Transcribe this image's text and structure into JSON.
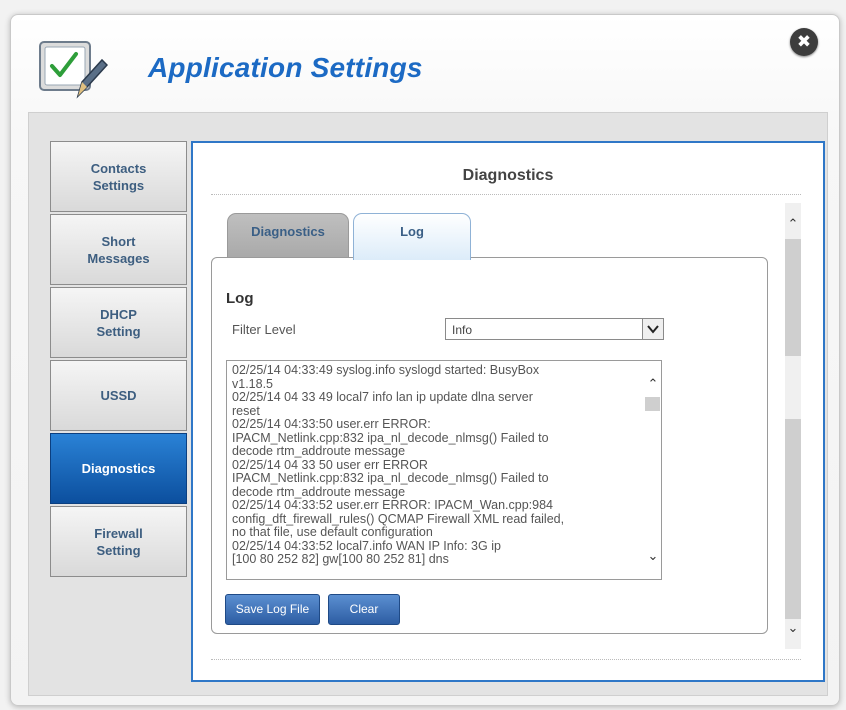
{
  "window": {
    "title": "Application Settings",
    "close_glyph": "✖",
    "app_icon": "checklist-pen-icon",
    "close_icon": "close-icon"
  },
  "sidebar": {
    "items": [
      {
        "label": "Contacts\nSettings",
        "active": false
      },
      {
        "label": "Short\nMessages",
        "active": false
      },
      {
        "label": "DHCP\nSetting",
        "active": false
      },
      {
        "label": "USSD",
        "active": false
      },
      {
        "label": "Diagnostics",
        "active": true
      },
      {
        "label": "Firewall\nSetting",
        "active": false
      }
    ]
  },
  "panel": {
    "title": "Diagnostics",
    "tabs": [
      {
        "label": "Diagnostics",
        "active": false
      },
      {
        "label": "Log",
        "active": true
      }
    ]
  },
  "log": {
    "heading": "Log",
    "filter_label": "Filter Level",
    "filter_value": "Info",
    "lines": [
      "02/25/14 04:33:49 syslog.info syslogd started: BusyBox",
      "v1.18.5",
      "02/25/14 04 33 49 local7 info  lan ip update dlna server",
      "reset",
      "02/25/14 04:33:50 user.err  ERROR:",
      "IPACM_Netlink.cpp:832 ipa_nl_decode_nlmsg() Failed to",
      "decode rtm_addroute message",
      "02/25/14 04 33 50 user err  ERROR",
      "IPACM_Netlink.cpp:832 ipa_nl_decode_nlmsg() Failed to",
      "decode rtm_addroute message",
      "02/25/14 04:33:52 user.err  ERROR: IPACM_Wan.cpp:984",
      "config_dft_firewall_rules() QCMAP Firewall XML read failed,",
      "no that file, use default configuration",
      "02/25/14 04:33:52 local7.info  WAN IP Info: 3G ip",
      "[100 80 252 82] gw[100 80 252 81] dns"
    ],
    "save_label": "Save Log File",
    "clear_label": "Clear"
  },
  "colors": {
    "title_blue": "#1c6ac4",
    "active_nav": "#0c4f9e",
    "panel_border": "#2f77c7",
    "button_blue": "#3b6db3"
  }
}
